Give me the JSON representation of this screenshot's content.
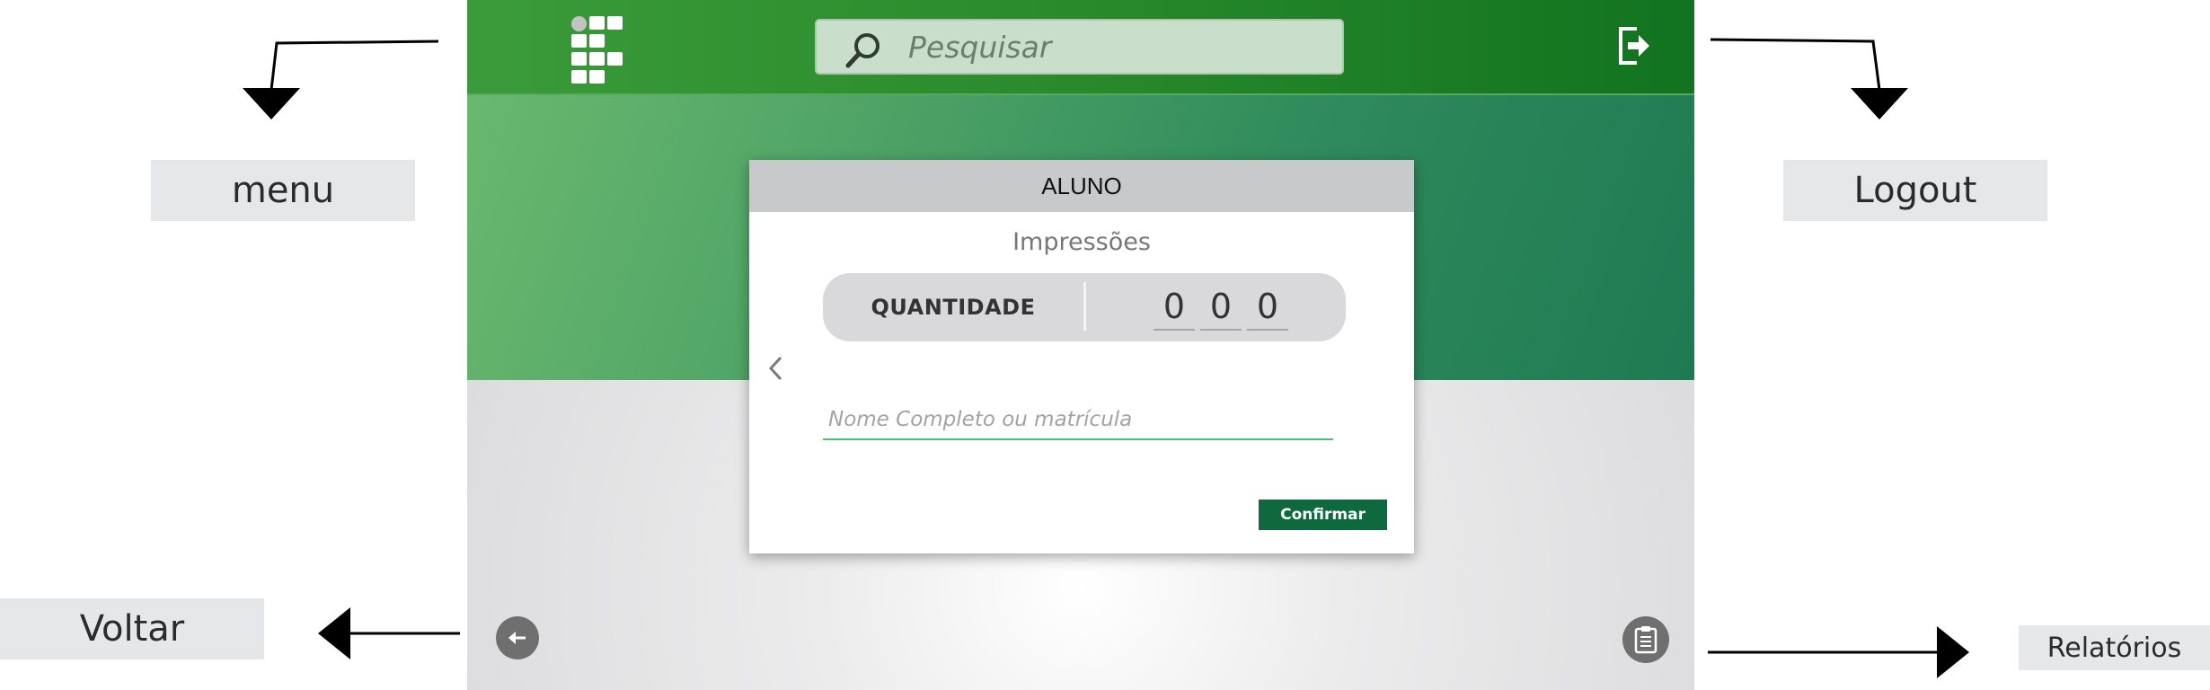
{
  "annotations": {
    "menu": "menu",
    "logout": "Logout",
    "voltar": "Voltar",
    "relatorios": "Relatórios"
  },
  "header": {
    "logo_icon": "institute-logo-icon",
    "search": {
      "placeholder": "Pesquisar",
      "icon": "search-icon"
    },
    "logout_icon": "logout-icon",
    "colors": {
      "header_start": "#3b9b3b",
      "header_end": "#127320"
    }
  },
  "card": {
    "title": "ALUNO",
    "subtitle": "Impressões",
    "quantity": {
      "label": "QUANTIDADE",
      "digits": [
        "0",
        "0",
        "0"
      ]
    },
    "name_input": {
      "placeholder": "Nome Completo ou matrícula"
    },
    "confirm_label": "Confirmar",
    "colors": {
      "confirm": "#0e6a3e",
      "input_underline": "#4cbd7a"
    }
  },
  "footer": {
    "back_icon": "arrow-left-icon",
    "reports_icon": "clipboard-icon"
  }
}
